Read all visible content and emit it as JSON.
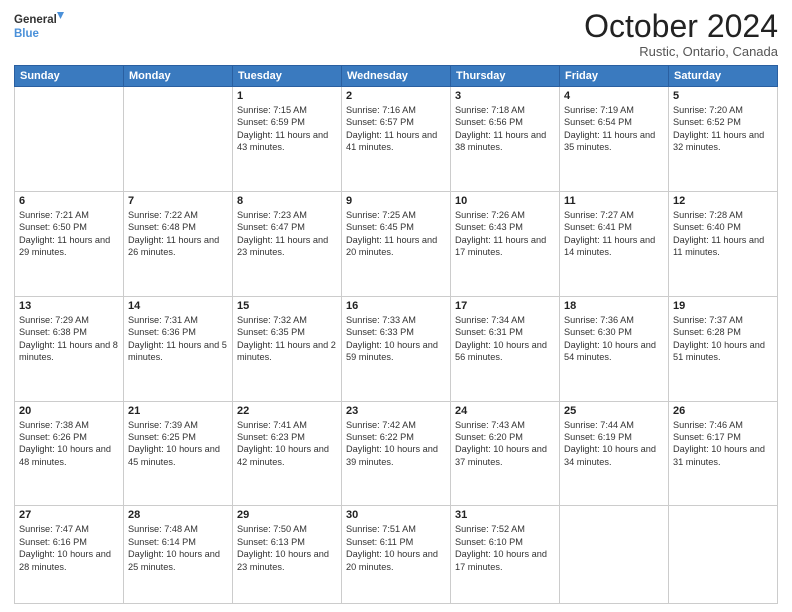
{
  "logo": {
    "line1": "General",
    "line2": "Blue"
  },
  "header": {
    "month": "October 2024",
    "location": "Rustic, Ontario, Canada"
  },
  "weekdays": [
    "Sunday",
    "Monday",
    "Tuesday",
    "Wednesday",
    "Thursday",
    "Friday",
    "Saturday"
  ],
  "weeks": [
    [
      {
        "day": "",
        "empty": true
      },
      {
        "day": "",
        "empty": true
      },
      {
        "day": "1",
        "sunrise": "7:15 AM",
        "sunset": "6:59 PM",
        "daylight": "11 hours and 43 minutes."
      },
      {
        "day": "2",
        "sunrise": "7:16 AM",
        "sunset": "6:57 PM",
        "daylight": "11 hours and 41 minutes."
      },
      {
        "day": "3",
        "sunrise": "7:18 AM",
        "sunset": "6:56 PM",
        "daylight": "11 hours and 38 minutes."
      },
      {
        "day": "4",
        "sunrise": "7:19 AM",
        "sunset": "6:54 PM",
        "daylight": "11 hours and 35 minutes."
      },
      {
        "day": "5",
        "sunrise": "7:20 AM",
        "sunset": "6:52 PM",
        "daylight": "11 hours and 32 minutes."
      }
    ],
    [
      {
        "day": "6",
        "sunrise": "7:21 AM",
        "sunset": "6:50 PM",
        "daylight": "11 hours and 29 minutes."
      },
      {
        "day": "7",
        "sunrise": "7:22 AM",
        "sunset": "6:48 PM",
        "daylight": "11 hours and 26 minutes."
      },
      {
        "day": "8",
        "sunrise": "7:23 AM",
        "sunset": "6:47 PM",
        "daylight": "11 hours and 23 minutes."
      },
      {
        "day": "9",
        "sunrise": "7:25 AM",
        "sunset": "6:45 PM",
        "daylight": "11 hours and 20 minutes."
      },
      {
        "day": "10",
        "sunrise": "7:26 AM",
        "sunset": "6:43 PM",
        "daylight": "11 hours and 17 minutes."
      },
      {
        "day": "11",
        "sunrise": "7:27 AM",
        "sunset": "6:41 PM",
        "daylight": "11 hours and 14 minutes."
      },
      {
        "day": "12",
        "sunrise": "7:28 AM",
        "sunset": "6:40 PM",
        "daylight": "11 hours and 11 minutes."
      }
    ],
    [
      {
        "day": "13",
        "sunrise": "7:29 AM",
        "sunset": "6:38 PM",
        "daylight": "11 hours and 8 minutes."
      },
      {
        "day": "14",
        "sunrise": "7:31 AM",
        "sunset": "6:36 PM",
        "daylight": "11 hours and 5 minutes."
      },
      {
        "day": "15",
        "sunrise": "7:32 AM",
        "sunset": "6:35 PM",
        "daylight": "11 hours and 2 minutes."
      },
      {
        "day": "16",
        "sunrise": "7:33 AM",
        "sunset": "6:33 PM",
        "daylight": "10 hours and 59 minutes."
      },
      {
        "day": "17",
        "sunrise": "7:34 AM",
        "sunset": "6:31 PM",
        "daylight": "10 hours and 56 minutes."
      },
      {
        "day": "18",
        "sunrise": "7:36 AM",
        "sunset": "6:30 PM",
        "daylight": "10 hours and 54 minutes."
      },
      {
        "day": "19",
        "sunrise": "7:37 AM",
        "sunset": "6:28 PM",
        "daylight": "10 hours and 51 minutes."
      }
    ],
    [
      {
        "day": "20",
        "sunrise": "7:38 AM",
        "sunset": "6:26 PM",
        "daylight": "10 hours and 48 minutes."
      },
      {
        "day": "21",
        "sunrise": "7:39 AM",
        "sunset": "6:25 PM",
        "daylight": "10 hours and 45 minutes."
      },
      {
        "day": "22",
        "sunrise": "7:41 AM",
        "sunset": "6:23 PM",
        "daylight": "10 hours and 42 minutes."
      },
      {
        "day": "23",
        "sunrise": "7:42 AM",
        "sunset": "6:22 PM",
        "daylight": "10 hours and 39 minutes."
      },
      {
        "day": "24",
        "sunrise": "7:43 AM",
        "sunset": "6:20 PM",
        "daylight": "10 hours and 37 minutes."
      },
      {
        "day": "25",
        "sunrise": "7:44 AM",
        "sunset": "6:19 PM",
        "daylight": "10 hours and 34 minutes."
      },
      {
        "day": "26",
        "sunrise": "7:46 AM",
        "sunset": "6:17 PM",
        "daylight": "10 hours and 31 minutes."
      }
    ],
    [
      {
        "day": "27",
        "sunrise": "7:47 AM",
        "sunset": "6:16 PM",
        "daylight": "10 hours and 28 minutes."
      },
      {
        "day": "28",
        "sunrise": "7:48 AM",
        "sunset": "6:14 PM",
        "daylight": "10 hours and 25 minutes."
      },
      {
        "day": "29",
        "sunrise": "7:50 AM",
        "sunset": "6:13 PM",
        "daylight": "10 hours and 23 minutes."
      },
      {
        "day": "30",
        "sunrise": "7:51 AM",
        "sunset": "6:11 PM",
        "daylight": "10 hours and 20 minutes."
      },
      {
        "day": "31",
        "sunrise": "7:52 AM",
        "sunset": "6:10 PM",
        "daylight": "10 hours and 17 minutes."
      },
      {
        "day": "",
        "empty": true
      },
      {
        "day": "",
        "empty": true
      }
    ]
  ]
}
